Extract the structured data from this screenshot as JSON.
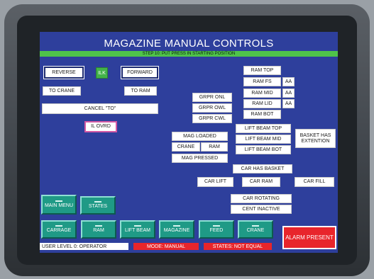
{
  "header": {
    "title": "MAGAZINE MANUAL CONTROLS",
    "step": "STEP 10: PUT PRESS IN STARTING POSITION"
  },
  "left_controls": {
    "reverse": "REVERSE",
    "ilk": "ILK",
    "forward": "FORWARD",
    "to_crane": "TO CRANE",
    "to_ram": "TO RAM",
    "cancel_to": "CANCEL \"TO\"",
    "il_ovrd": "IL OVRD"
  },
  "gripper": [
    "GRPR ONL",
    "GRPR OWL",
    "GRPR CWL"
  ],
  "ram": {
    "top": "RAM TOP",
    "fs": "RAM FS",
    "mid": "RAM MID",
    "lid": "RAM LID",
    "bot": "RAM BOT",
    "aa": "AA"
  },
  "mag": {
    "loaded": "MAG LOADED",
    "crane": "CRANE",
    "ram": "RAM",
    "pressed": "MAG PRESSED"
  },
  "lift_beam": {
    "top": "LIFT BEAM TOP",
    "mid": "LIFT BEAM MID",
    "bot": "LIFT BEAM BOT"
  },
  "basket_ext": "BASKET HAS EXTENTION",
  "car": {
    "has_basket": "CAR HAS BASKET",
    "lift": "CAR LIFT",
    "ram": "CAR RAM",
    "fill": "CAR FILL",
    "rotating": "CAR ROTATING",
    "cent_inactive": "CENT INACTIVE"
  },
  "nav_buttons": {
    "main_menu": "MAIN MENU",
    "states": "STATES",
    "carriage": "CARRAGE",
    "ram": "RAM",
    "lift_beam": "LIFT BEAM",
    "magazine": "MAGAZINE",
    "feed": "FEED",
    "crane": "CRANE"
  },
  "alarm": "ALARM PRESENT",
  "status": {
    "user_level": "USER LEVEL 0: OPERATOR",
    "mode": "MODE: MANUAL",
    "states": "STATES: NOT EQUAL"
  },
  "colors": {
    "screen_bg": "#2e3f9c",
    "step_bar": "#4fc34a",
    "nav_button": "#1f9a86",
    "alarm": "#e8252b"
  }
}
